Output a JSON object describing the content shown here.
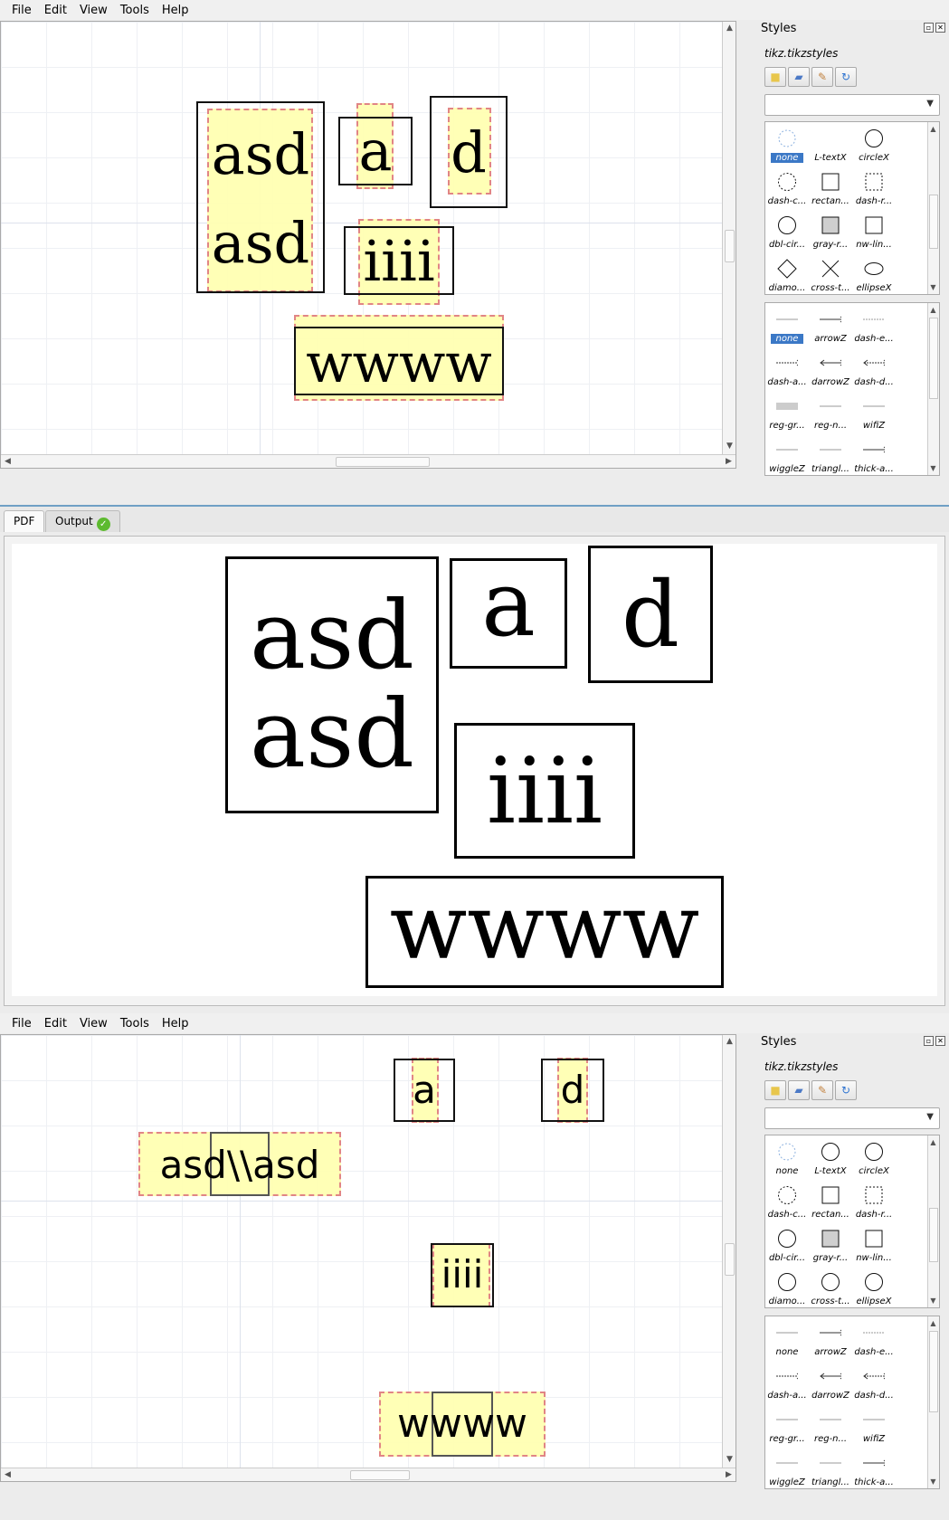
{
  "menu": [
    "File",
    "Edit",
    "View",
    "Tools",
    "Help"
  ],
  "styles_panel": {
    "title": "Styles",
    "file": "tikz.tikzstyles",
    "node_styles": [
      "none",
      "L-textX",
      "circleX",
      "dash-c...",
      "rectan...",
      "dash-r...",
      "dbl-cir...",
      "gray-r...",
      "nw-lin...",
      "diamo...",
      "cross-t...",
      "ellipseX"
    ],
    "edge_styles": [
      "none",
      "arrowZ",
      "dash-e...",
      "dash-a...",
      "darrowZ",
      "dash-d...",
      "reg-gr...",
      "reg-n...",
      "wifiZ",
      "wiggleZ",
      "triangl...",
      "thick-a..."
    ]
  },
  "top_editor": {
    "nodes": [
      {
        "lines": [
          "asd",
          "asd"
        ]
      },
      {
        "lines": [
          "a"
        ]
      },
      {
        "lines": [
          "d"
        ]
      },
      {
        "lines": [
          "iiii"
        ]
      },
      {
        "lines": [
          "wwww"
        ]
      }
    ]
  },
  "tabs": {
    "pdf": "PDF",
    "output": "Output",
    "output_status": "✓"
  },
  "pdf": {
    "nodes": [
      {
        "lines": [
          "asd",
          "asd"
        ]
      },
      {
        "lines": [
          "a"
        ]
      },
      {
        "lines": [
          "d"
        ]
      },
      {
        "lines": [
          "iiii"
        ]
      },
      {
        "lines": [
          "wwww"
        ]
      }
    ]
  },
  "bottom_editor": {
    "nodes": [
      "asd\\\\asd",
      "a",
      "d",
      "iiii",
      "wwww"
    ]
  }
}
